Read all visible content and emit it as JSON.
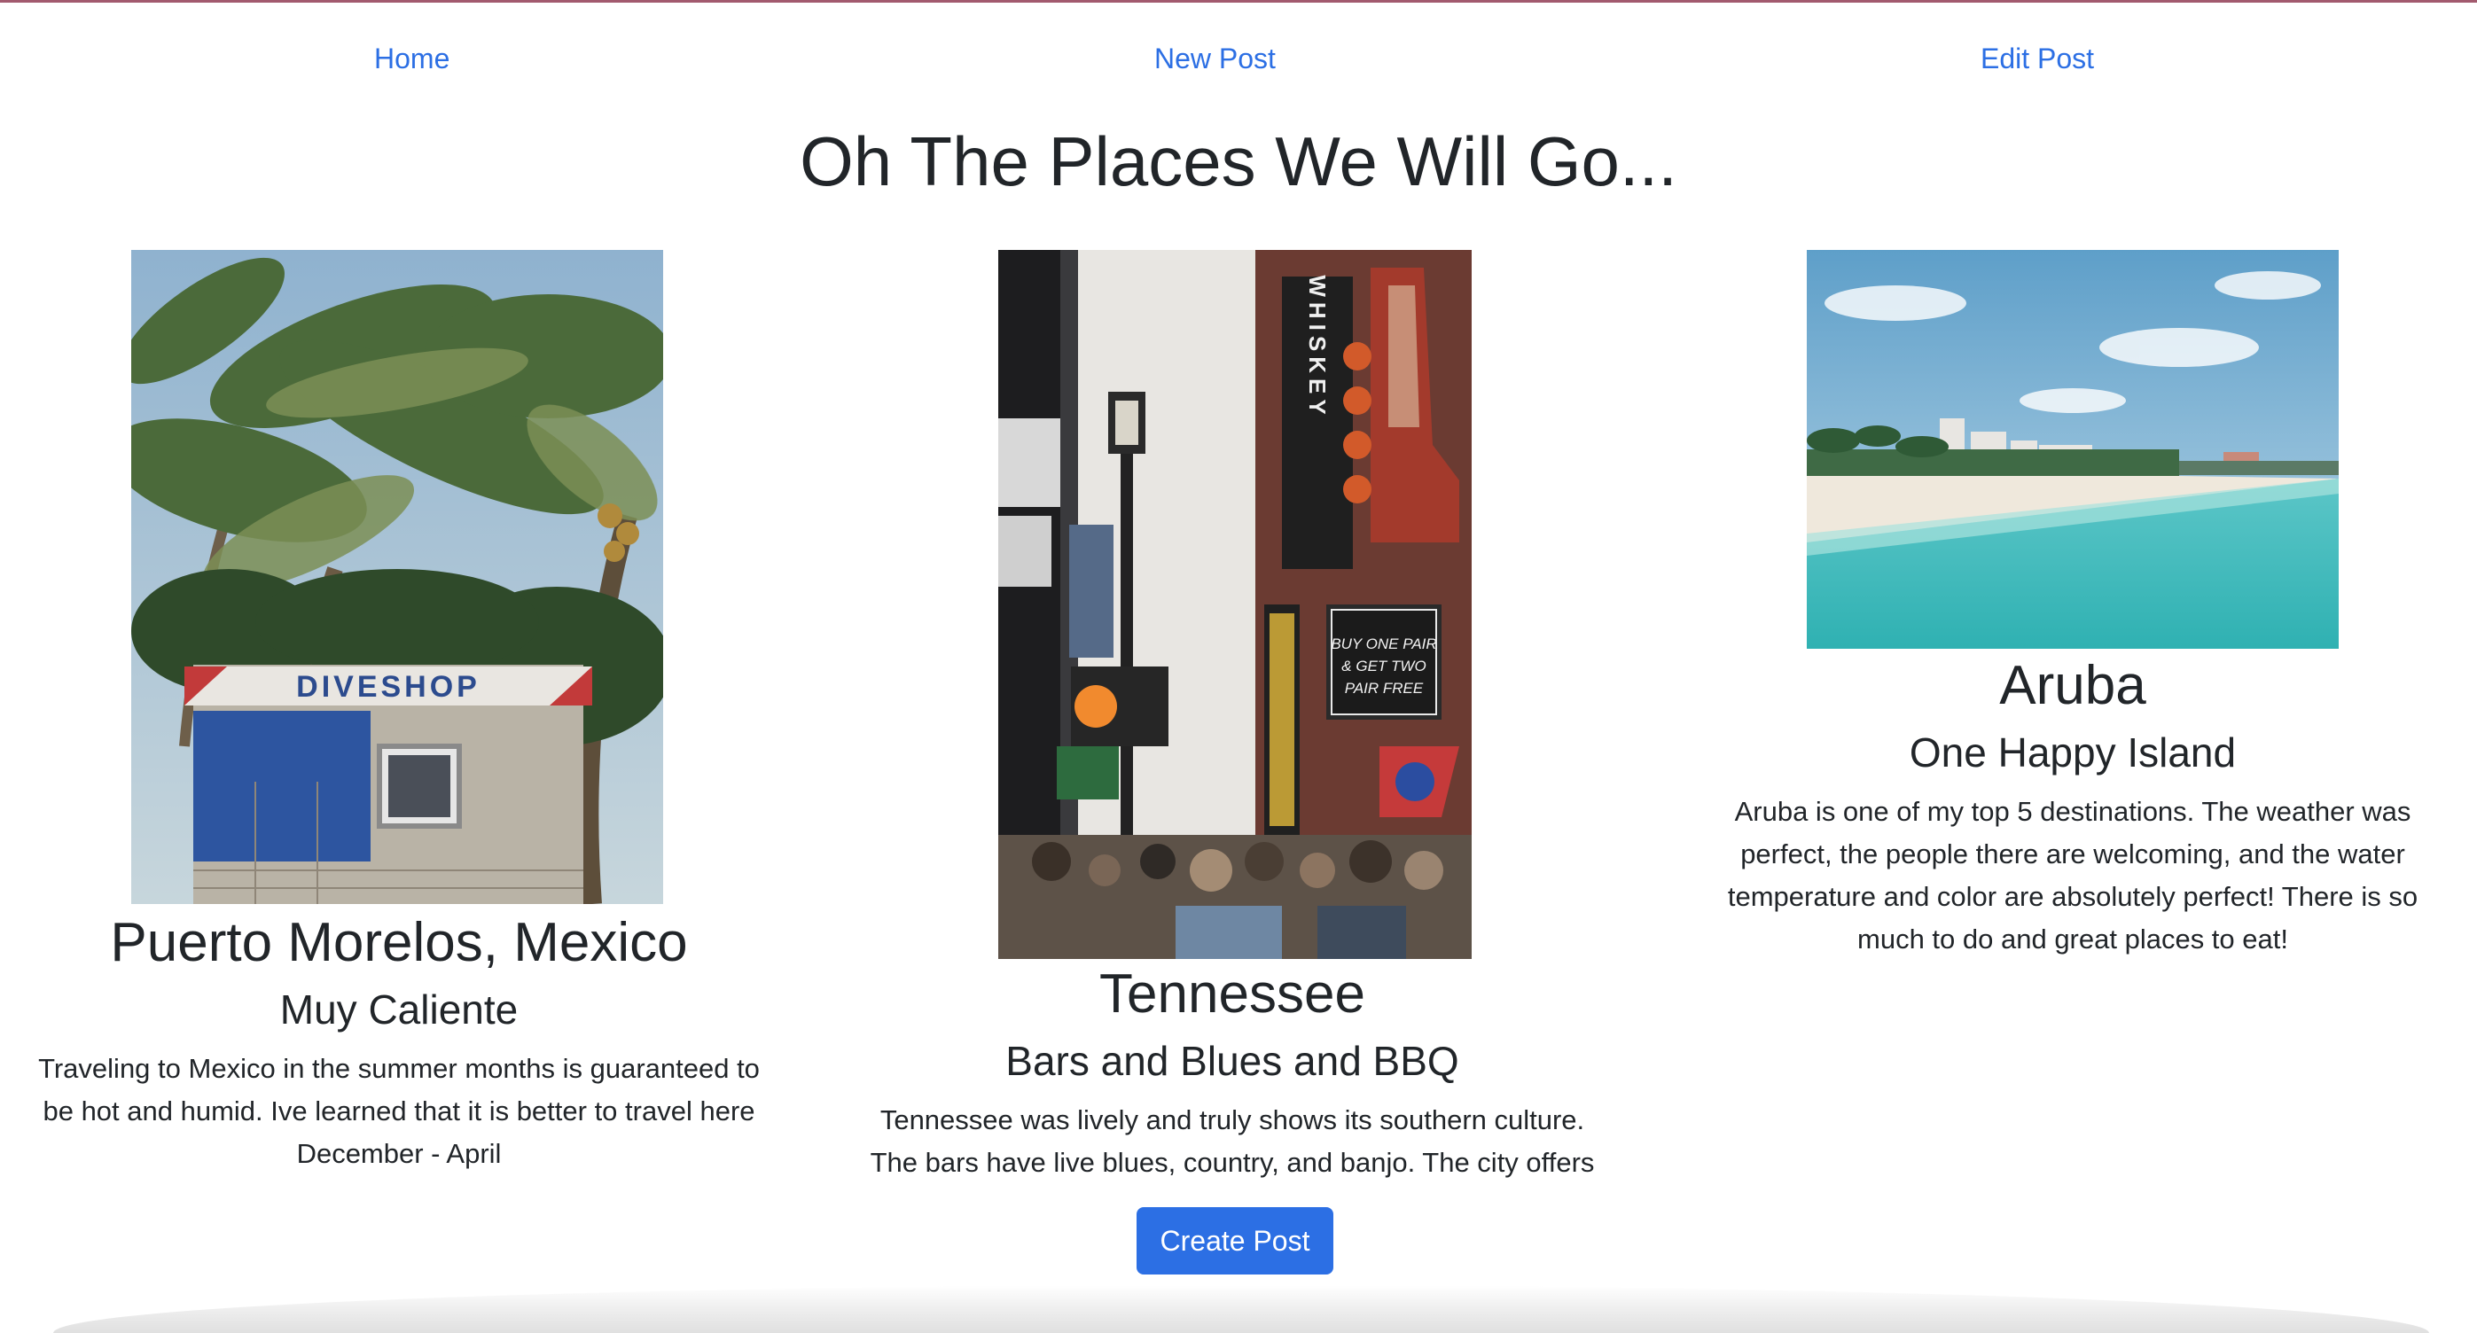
{
  "nav": {
    "home_label": "Home",
    "new_post_label": "New Post",
    "edit_post_label": "Edit Post"
  },
  "page_title": "Oh The Places We Will Go...",
  "posts": [
    {
      "place": "Puerto Morelos, Mexico",
      "tagline": "Muy Caliente",
      "description": "Traveling to Mexico in the summer months is guaranteed to be hot and humid. Ive learned that it is better to travel here December - April",
      "photo_sign_text": "DIVESHOP"
    },
    {
      "place": "Tennessee",
      "tagline": "Bars and Blues and BBQ",
      "description": "Tennessee was lively and truly shows its southern culture. The bars have live blues, country, and banjo. The city offers great eateries with authentic bbq as it",
      "photo_sign_text": "WHISKEY",
      "photo_sign2_text": "BUY ONE PAIR & GET TWO PAIR FREE"
    },
    {
      "place": "Aruba",
      "tagline": "One Happy Island",
      "description": "Aruba is one of my top 5 destinations. The weather was perfect, the people there are welcoming, and the water temperature and color are absolutely perfect! There is so much to do and great places to eat!"
    }
  ],
  "create_post_label": "Create Post",
  "colors": {
    "link": "#2c6fe4",
    "button": "#2c6fe4",
    "text": "#212529"
  }
}
